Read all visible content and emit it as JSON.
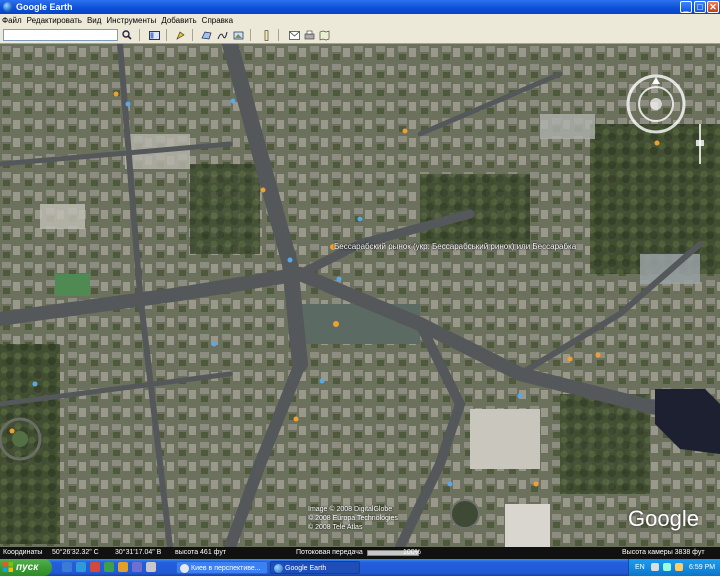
{
  "window": {
    "title": "Google Earth",
    "min_symbol": "_",
    "max_symbol": "□",
    "close_symbol": "✕"
  },
  "menu": {
    "items": [
      "Файл",
      "Редактировать",
      "Вид",
      "Инструменты",
      "Добавить",
      "Справка"
    ]
  },
  "toolbar": {
    "search_value": "",
    "dropdown_symbol": "▾",
    "icons": [
      "search-icon",
      "sidebar-toggle-icon",
      "placemark-icon",
      "polygon-icon",
      "path-icon",
      "overlay-icon",
      "ruler-icon",
      "email-icon",
      "print-icon",
      "maps-icon"
    ]
  },
  "map": {
    "place_label": "Бессарабский рынок (укр. Бессарабський ринок) или Бессарабка",
    "copyright_lines": [
      "Image © 2008 DigitalGlobe",
      "© 2008 Europa Technologies",
      "© 2008 Tele Atlas"
    ],
    "logo_text": "Google"
  },
  "status": {
    "coords_label": "Координаты",
    "lat": "50°26'32.32\" С",
    "lon": "30°31'17.04\" В",
    "elevation": "высота   461 фут",
    "streaming_label": "Потоковая передача",
    "streaming_percent": "100%",
    "streaming_fraction": 1.0,
    "eye_alt": "Высота камеры   3838 фут"
  },
  "taskbar": {
    "start_label": "пуск",
    "tasks": [
      {
        "label": "Киев в перспективе...",
        "active": false
      },
      {
        "label": "Google Earth",
        "active": true
      }
    ],
    "tray_lang": "EN",
    "clock": "6:59 PM"
  },
  "colors": {
    "titlebar": "#0a4fd6",
    "taskbar": "#245edb",
    "start": "#3c9b37",
    "tray": "#138be0",
    "statusbar": "#111111"
  }
}
